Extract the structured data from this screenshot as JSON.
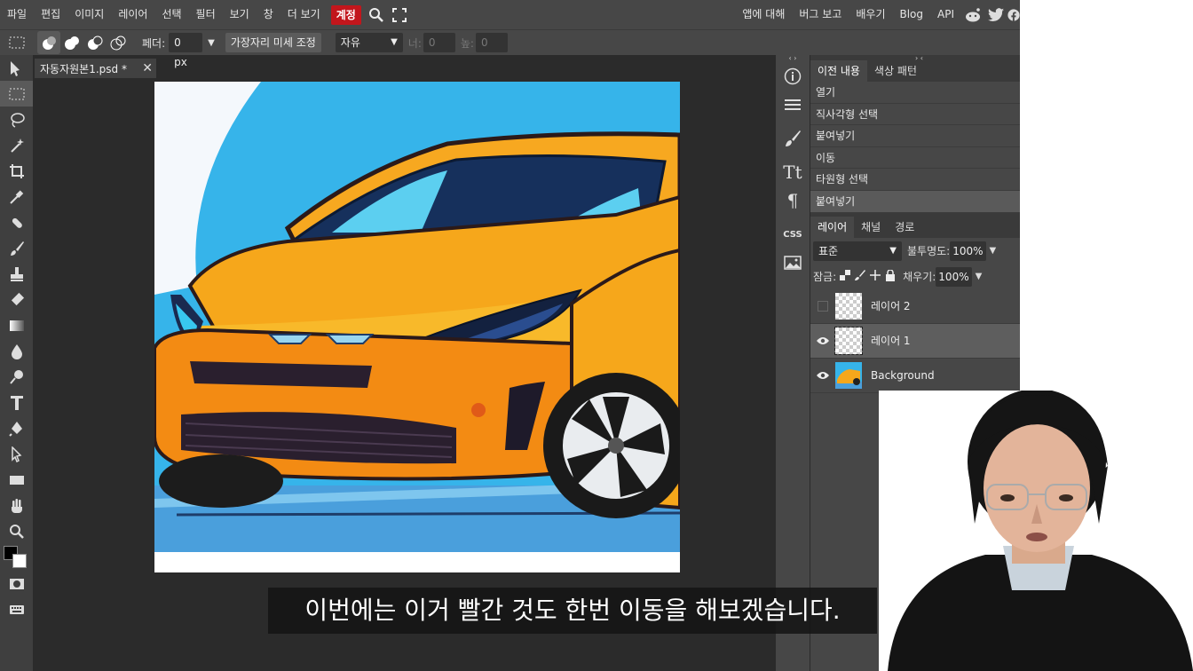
{
  "menu": {
    "items": [
      "파일",
      "편집",
      "이미지",
      "레이어",
      "선택",
      "필터",
      "보기",
      "창",
      "더 보기"
    ],
    "account": "계정",
    "right_items": [
      "앱에 대해",
      "버그 보고",
      "배우기",
      "Blog",
      "API"
    ]
  },
  "options": {
    "feather_label": "페더:",
    "feather_value": "0 px",
    "refine_edge": "가장자리 미세 조정",
    "style_value": "자유",
    "width_label": "너:",
    "width_value": "0",
    "height_label": "높:",
    "height_value": "0"
  },
  "document": {
    "tab_title": "자동자원본1.psd *"
  },
  "history": {
    "tabs": [
      "이전 내용",
      "색상 패턴"
    ],
    "items": [
      "열기",
      "직사각형 선택",
      "붙여넣기",
      "이동",
      "타원형 선택",
      "붙여넣기"
    ]
  },
  "layers": {
    "tabs": [
      "레이어",
      "채널",
      "경로"
    ],
    "blend_mode": "표준",
    "opacity_label": "불투명도:",
    "opacity_value": "100%",
    "lock_label": "잠금:",
    "fill_label": "채우기:",
    "fill_value": "100%",
    "items": [
      {
        "name": "레이어 2",
        "visible": false
      },
      {
        "name": "레이어 1",
        "visible": true,
        "selected": true
      },
      {
        "name": "Background",
        "visible": true
      }
    ]
  },
  "subtitle": "이번에는 이거 빨간 것도 한번 이동을 해보겠습니다.",
  "colors": {
    "account_red": "#c2161c",
    "canvas_sky": "#36b4ea",
    "car_body": "#f6a71b"
  }
}
